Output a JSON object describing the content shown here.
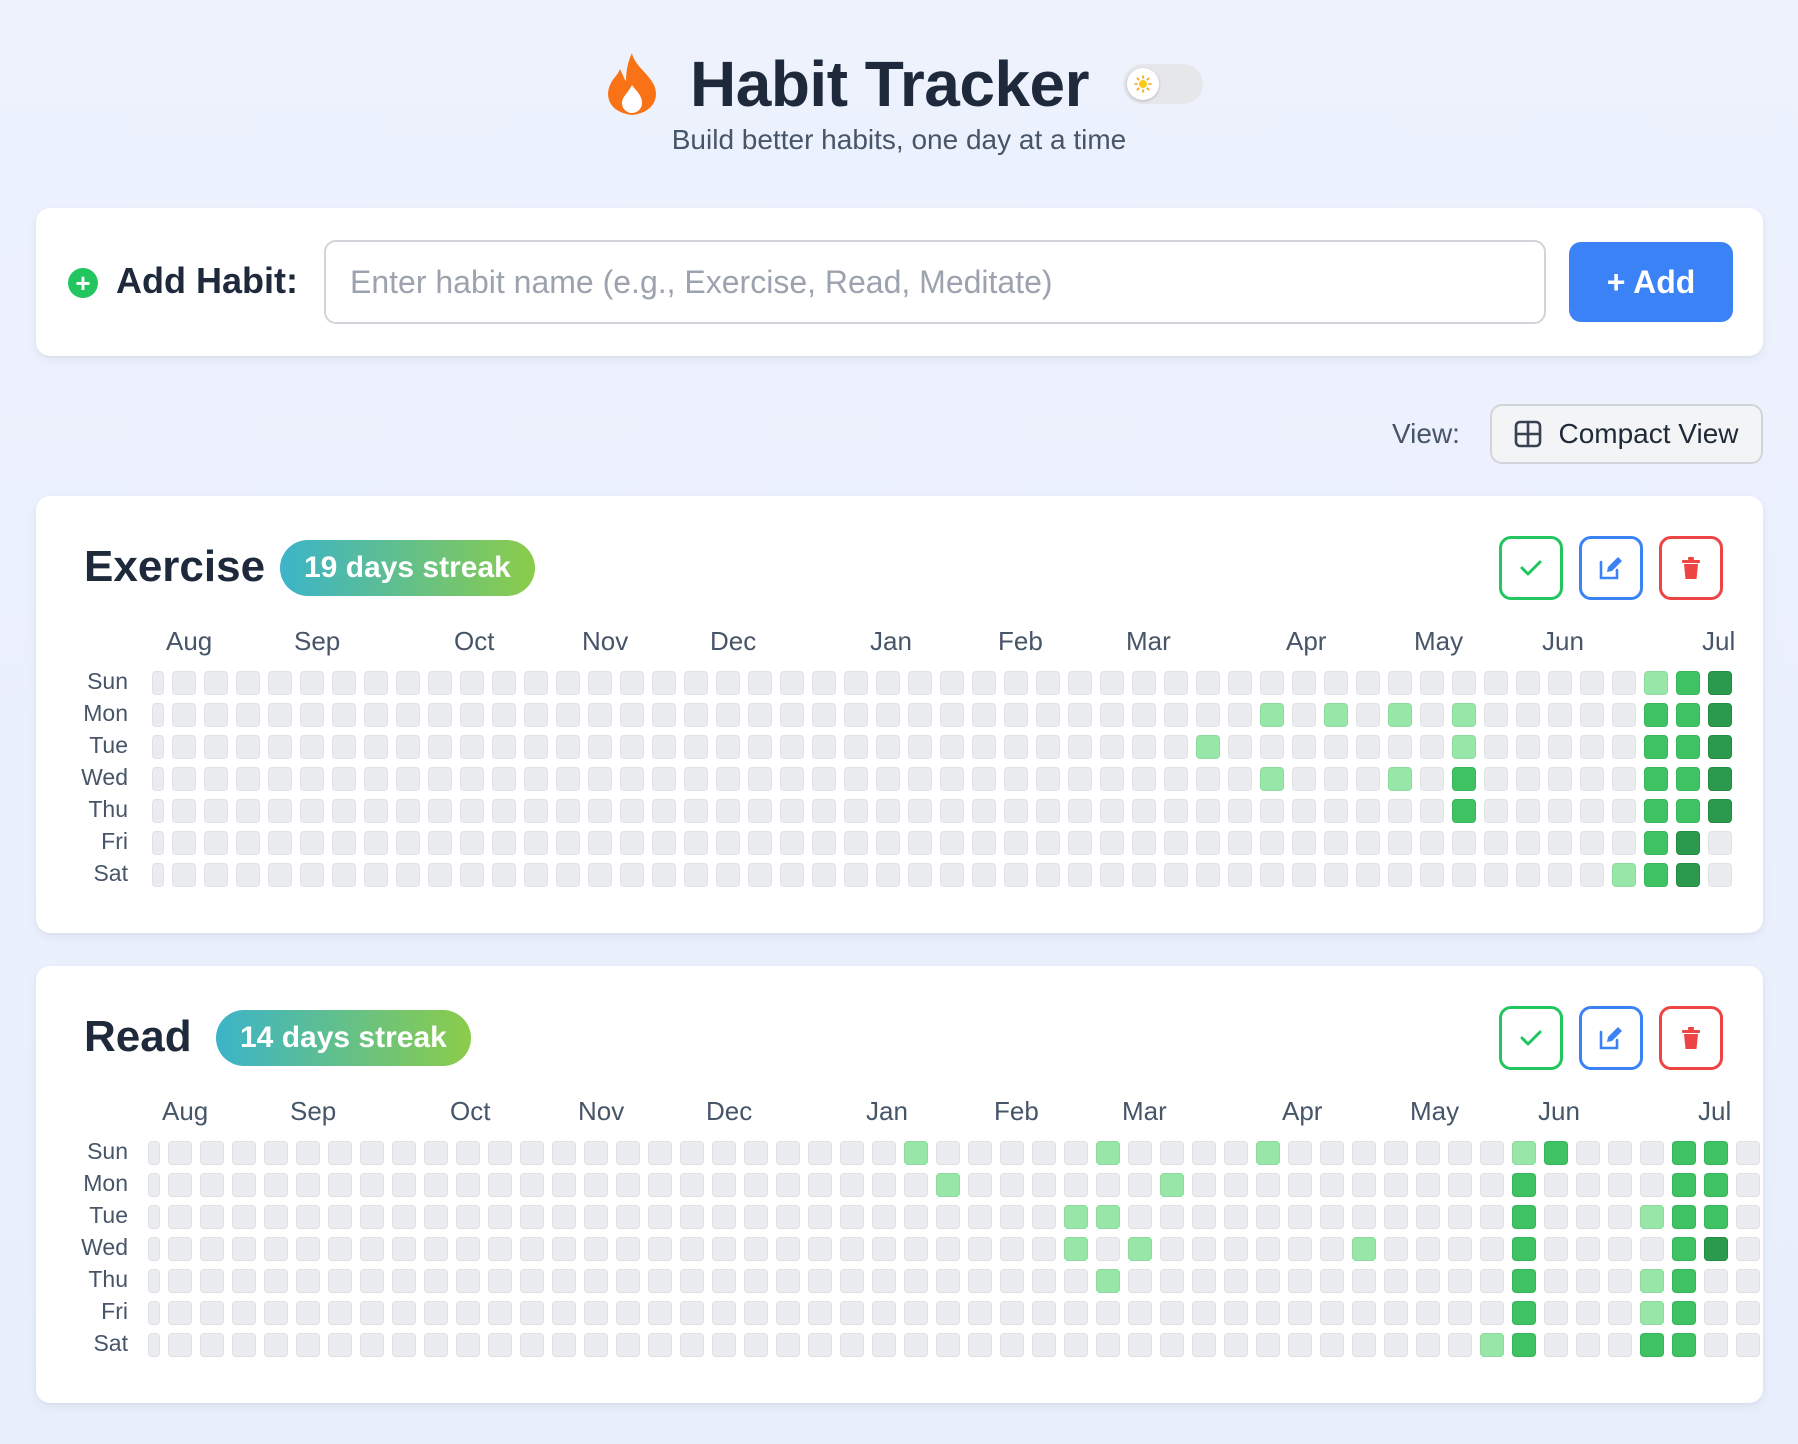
{
  "header": {
    "title": "Habit Tracker",
    "subtitle": "Build better habits, one day at a time"
  },
  "add_habit": {
    "label": "Add Habit:",
    "placeholder": "Enter habit name (e.g., Exercise, Read, Meditate)",
    "button_label": "+ Add"
  },
  "view": {
    "label": "View:",
    "button_label": "Compact View"
  },
  "colors": {
    "accent": "#3b82f6",
    "success": "#22c55e",
    "danger": "#ef4444",
    "level1": "#98e7a8",
    "level2": "#3fc263",
    "level3": "#2b9a4d"
  },
  "day_labels": [
    "Sun",
    "Mon",
    "Tue",
    "Wed",
    "Thu",
    "Fri",
    "Sat"
  ],
  "habits": [
    {
      "name": "Exercise",
      "streak": "19 days streak",
      "months": [
        {
          "label": "Aug",
          "week": 1
        },
        {
          "label": "Sep",
          "week": 5
        },
        {
          "label": "Oct",
          "week": 10
        },
        {
          "label": "Nov",
          "week": 14
        },
        {
          "label": "Dec",
          "week": 18
        },
        {
          "label": "Jan",
          "week": 23
        },
        {
          "label": "Feb",
          "week": 27
        },
        {
          "label": "Mar",
          "week": 31
        },
        {
          "label": "Apr",
          "week": 36
        },
        {
          "label": "May",
          "week": 40
        },
        {
          "label": "Jun",
          "week": 44
        },
        {
          "label": "Jul",
          "week": 49
        }
      ],
      "completions": [
        [
          47,
          0,
          1
        ],
        [
          48,
          0,
          2
        ],
        [
          49,
          0,
          3
        ],
        [
          35,
          1,
          1
        ],
        [
          37,
          1,
          1
        ],
        [
          39,
          1,
          1
        ],
        [
          41,
          1,
          1
        ],
        [
          47,
          1,
          2
        ],
        [
          48,
          1,
          2
        ],
        [
          49,
          1,
          3
        ],
        [
          33,
          2,
          1
        ],
        [
          41,
          2,
          1
        ],
        [
          47,
          2,
          2
        ],
        [
          48,
          2,
          2
        ],
        [
          49,
          2,
          3
        ],
        [
          35,
          3,
          1
        ],
        [
          39,
          3,
          1
        ],
        [
          41,
          3,
          2
        ],
        [
          47,
          3,
          2
        ],
        [
          48,
          3,
          2
        ],
        [
          49,
          3,
          3
        ],
        [
          41,
          4,
          2
        ],
        [
          47,
          4,
          2
        ],
        [
          48,
          4,
          2
        ],
        [
          49,
          4,
          3
        ],
        [
          47,
          5,
          2
        ],
        [
          48,
          5,
          3
        ],
        [
          46,
          6,
          1
        ],
        [
          47,
          6,
          2
        ],
        [
          48,
          6,
          3
        ]
      ]
    },
    {
      "name": "Read",
      "streak": "14 days streak",
      "months": [
        {
          "label": "Aug",
          "week": 1
        },
        {
          "label": "Sep",
          "week": 5
        },
        {
          "label": "Oct",
          "week": 10
        },
        {
          "label": "Nov",
          "week": 14
        },
        {
          "label": "Dec",
          "week": 18
        },
        {
          "label": "Jan",
          "week": 23
        },
        {
          "label": "Feb",
          "week": 27
        },
        {
          "label": "Mar",
          "week": 31
        },
        {
          "label": "Apr",
          "week": 36
        },
        {
          "label": "May",
          "week": 40
        },
        {
          "label": "Jun",
          "week": 44
        },
        {
          "label": "Jul",
          "week": 49
        }
      ],
      "completions": [
        [
          24,
          0,
          1
        ],
        [
          30,
          0,
          1
        ],
        [
          35,
          0,
          1
        ],
        [
          43,
          0,
          1
        ],
        [
          44,
          0,
          2
        ],
        [
          48,
          0,
          2
        ],
        [
          49,
          0,
          2
        ],
        [
          25,
          1,
          1
        ],
        [
          32,
          1,
          1
        ],
        [
          43,
          1,
          2
        ],
        [
          48,
          1,
          2
        ],
        [
          49,
          1,
          2
        ],
        [
          29,
          2,
          1
        ],
        [
          30,
          2,
          1
        ],
        [
          43,
          2,
          2
        ],
        [
          47,
          2,
          1
        ],
        [
          48,
          2,
          2
        ],
        [
          49,
          2,
          2
        ],
        [
          29,
          3,
          1
        ],
        [
          31,
          3,
          1
        ],
        [
          38,
          3,
          1
        ],
        [
          43,
          3,
          2
        ],
        [
          48,
          3,
          2
        ],
        [
          49,
          3,
          3
        ],
        [
          30,
          4,
          1
        ],
        [
          43,
          4,
          2
        ],
        [
          47,
          4,
          1
        ],
        [
          48,
          4,
          2
        ],
        [
          43,
          5,
          2
        ],
        [
          47,
          5,
          1
        ],
        [
          48,
          5,
          2
        ],
        [
          42,
          6,
          1
        ],
        [
          43,
          6,
          2
        ],
        [
          47,
          6,
          2
        ],
        [
          48,
          6,
          2
        ]
      ]
    }
  ]
}
